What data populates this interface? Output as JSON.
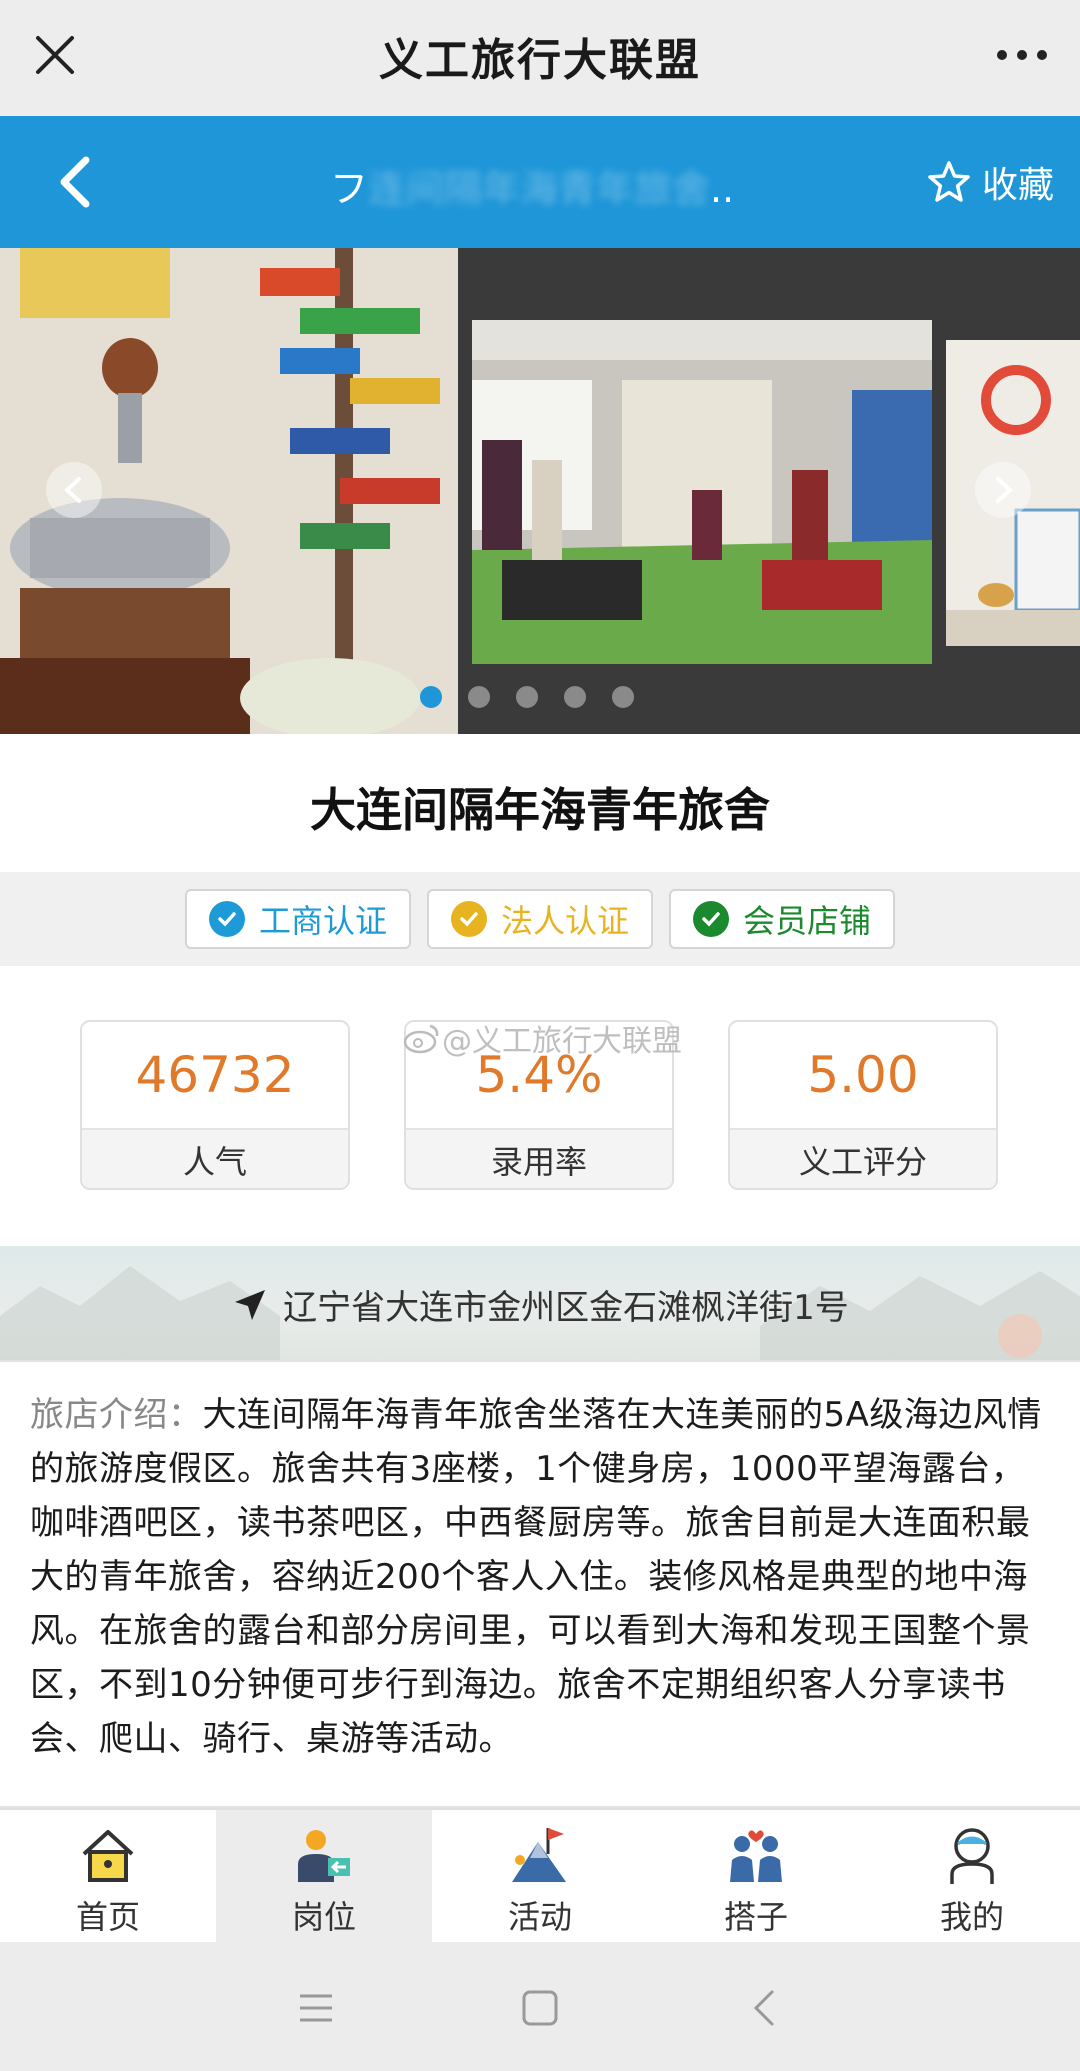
{
  "wechat": {
    "title": "义工旅行大联盟"
  },
  "header": {
    "title_visible": "大连间隔年海青年...",
    "title_prefix": "フ",
    "title_blurred": "连间隔年海青年旅舍",
    "title_ellipsis": "...",
    "favorite_label": "收藏",
    "bar_color": "#1e96d8"
  },
  "carousel": {
    "slide_count": 5,
    "active_index": 0,
    "active_dot_color": "#1e96d8"
  },
  "hostel": {
    "name": "大连间隔年海青年旅舍"
  },
  "badges": [
    {
      "label": "工商认证",
      "color": "#1e9bd7",
      "icon": "check-circle-icon"
    },
    {
      "label": "法人认证",
      "color": "#e8b321",
      "icon": "check-circle-icon"
    },
    {
      "label": "会员店铺",
      "color": "#1b8a2e",
      "icon": "check-circle-icon"
    }
  ],
  "stats": [
    {
      "value": "46732",
      "label": "人气"
    },
    {
      "value": "5.4%",
      "label": "录用率"
    },
    {
      "value": "5.00",
      "label": "义工评分"
    }
  ],
  "watermark": "@义工旅行大联盟",
  "address": {
    "text": "辽宁省大连市金州区金石滩枫洋街1号"
  },
  "intro": {
    "lead": "旅店介绍：",
    "body": "大连间隔年海青年旅舍坐落在大连美丽的5A级海边风情的旅游度假区。旅舍共有3座楼，1个健身房，1000平望海露台，咖啡酒吧区，读书茶吧区，中西餐厨房等。旅舍目前是大连面积最大的青年旅舍，容纳近200个客人入住。装修风格是典型的地中海风。在旅舍的露台和部分房间里，可以看到大海和发现王国整个景区，不到10分钟便可步行到海边。旅舍不定期组织客人分享读书会、爬山、骑行、桌游等活动。"
  },
  "tabs": [
    {
      "label": "首页",
      "icon": "home-icon"
    },
    {
      "label": "岗位",
      "icon": "job-icon",
      "active": true
    },
    {
      "label": "活动",
      "icon": "mountain-flag-icon"
    },
    {
      "label": "搭子",
      "icon": "partners-icon"
    },
    {
      "label": "我的",
      "icon": "profile-icon"
    }
  ],
  "accent_orange": "#e07a2a"
}
